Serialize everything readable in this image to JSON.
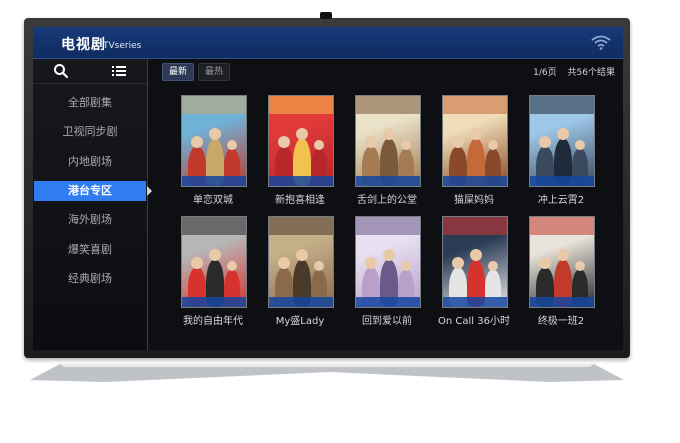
{
  "header": {
    "title": "电视剧",
    "subtitle": "TVseries",
    "wifi_icon": "wifi-icon"
  },
  "sidebar": {
    "tools": [
      {
        "icon": "search-icon"
      },
      {
        "icon": "list-icon"
      }
    ],
    "items": [
      {
        "label": "全部剧集",
        "active": false
      },
      {
        "label": "卫视同步剧",
        "active": false
      },
      {
        "label": "内地剧场",
        "active": false
      },
      {
        "label": "港台专区",
        "active": true
      },
      {
        "label": "海外剧场",
        "active": false
      },
      {
        "label": "爆笑喜剧",
        "active": false
      },
      {
        "label": "经典剧场",
        "active": false
      }
    ]
  },
  "main": {
    "tabs": [
      {
        "label": "最新",
        "active": true
      },
      {
        "label": "最热",
        "active": false
      }
    ],
    "page_indicator": "1/6页",
    "result_count": "共56个结果",
    "posters": [
      {
        "title": "单恋双城",
        "colors": [
          "#6fb3d9",
          "#c9a86a",
          "#c0392b"
        ]
      },
      {
        "title": "新抱喜相逢",
        "colors": [
          "#e23a3a",
          "#f2c14e",
          "#b8272a"
        ]
      },
      {
        "title": "舌剑上的公堂",
        "colors": [
          "#e9e1c8",
          "#7a5a3a",
          "#a47b52"
        ]
      },
      {
        "title": "猫屎妈妈",
        "colors": [
          "#f0dcb8",
          "#c46a3a",
          "#8a4a2a"
        ]
      },
      {
        "title": "冲上云霄2",
        "colors": [
          "#9ec7e8",
          "#1f2a3a",
          "#3a4a5e"
        ]
      },
      {
        "title": "我的自由年代",
        "colors": [
          "#b7b7b7",
          "#2a2a2a",
          "#d6332f"
        ]
      },
      {
        "title": "My盛Lady",
        "colors": [
          "#c5b08a",
          "#4a3a2a",
          "#8a6a4a"
        ]
      },
      {
        "title": "回到爱以前",
        "colors": [
          "#e8e0f0",
          "#6a5a8a",
          "#b8a0c8"
        ]
      },
      {
        "title": "On Call 36小时",
        "colors": [
          "#2b3c55",
          "#d6332f",
          "#e5e5e5"
        ]
      },
      {
        "title": "终极一班2",
        "colors": [
          "#e7e3da",
          "#c23a2a",
          "#2a2a2a"
        ]
      }
    ]
  },
  "colors": {
    "header_bg": "#173a78",
    "accent": "#2f7df0",
    "screen_bg": "#0d0f12"
  }
}
